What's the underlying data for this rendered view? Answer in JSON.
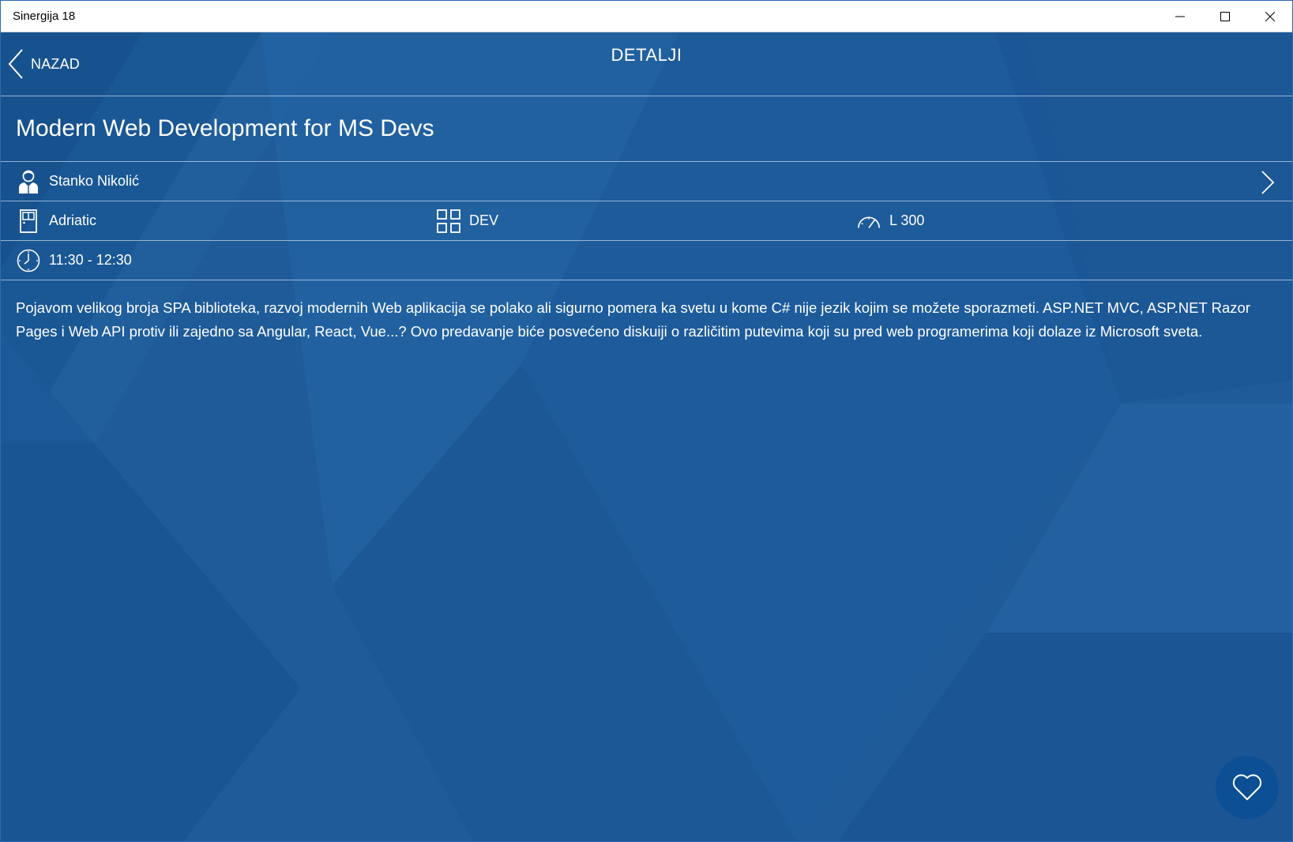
{
  "window": {
    "title": "Sinergija 18",
    "controls": [
      "minimize",
      "maximize",
      "close"
    ]
  },
  "header": {
    "back_label": "NAZAD",
    "page_title": "DETALJI"
  },
  "session": {
    "title": "Modern Web Development for MS Devs",
    "speaker": "Stanko Nikolić",
    "room": "Adriatic",
    "track": "DEV",
    "level": "L 300",
    "time": "11:30 - 12:30",
    "description": "Pojavom velikog broja SPA biblioteka, razvoj modernih Web aplikacija se polako ali sigurno pomera ka svetu u kome C# nije jezik kojim se možete sporazmeti. ASP.NET MVC, ASP.NET Razor Pages i Web API protiv ili zajedno sa Angular, React, Vue...? Ovo predavanje biće posvećeno diskuiji o različitim putevima koji su pred web programerima koji dolaze iz Microsoft sveta."
  },
  "icons": {
    "back": "chevron-left-icon",
    "speaker": "person-icon",
    "speaker_more": "chevron-right-icon",
    "room": "door-icon",
    "track": "grid-icon",
    "level": "speedometer-icon",
    "time": "clock-icon",
    "favorite": "heart-icon"
  },
  "colors": {
    "background": "#1f5a98",
    "favorite_button": "#0d4f94",
    "text": "#ffffff"
  }
}
